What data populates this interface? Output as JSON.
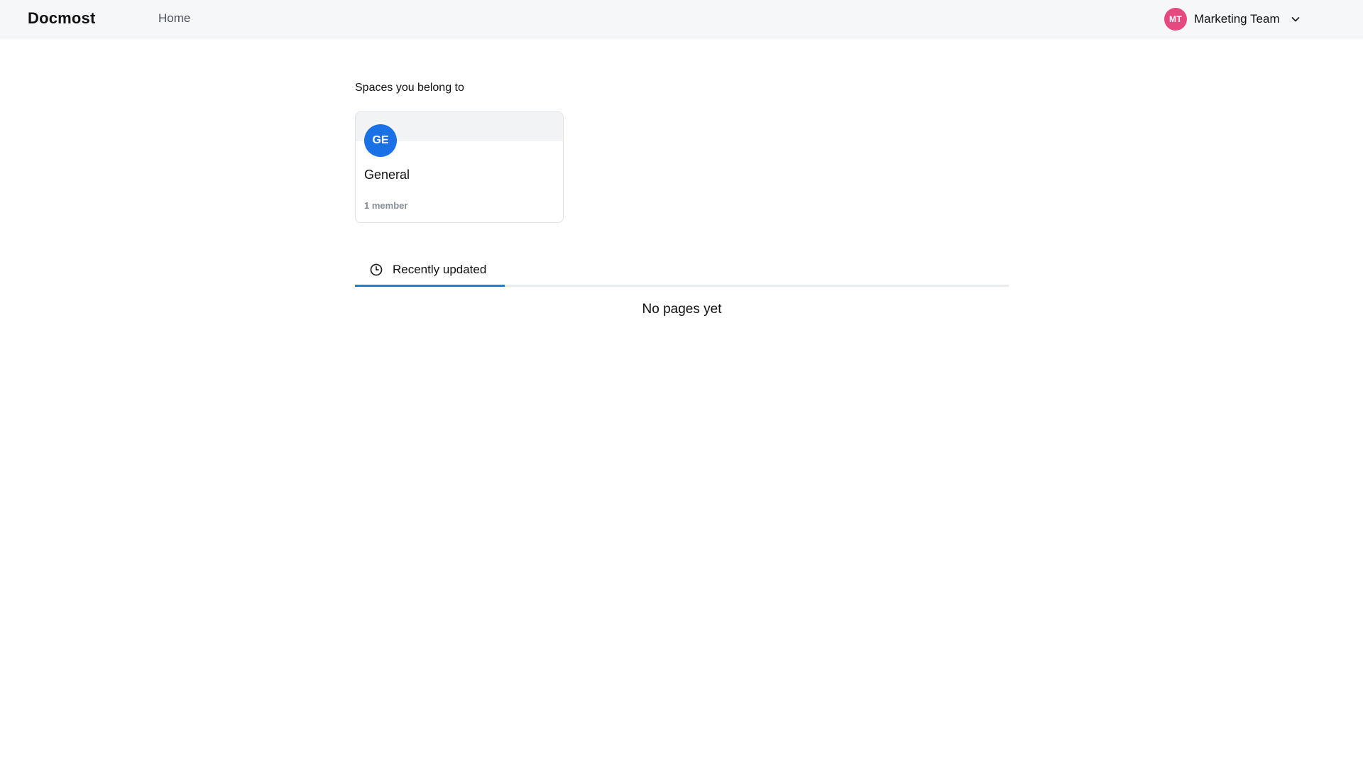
{
  "app": {
    "title": "Docmost"
  },
  "nav": {
    "home_label": "Home"
  },
  "workspace": {
    "initials": "MT",
    "name": "Marketing Team",
    "avatar_color": "#e64980",
    "chevron_icon": "chevron-down-icon"
  },
  "spaces_section": {
    "title": "Spaces you belong to",
    "spaces": [
      {
        "initials": "GE",
        "name": "General",
        "members": "1 member",
        "avatar_color": "#1971e5"
      }
    ]
  },
  "tabs": [
    {
      "label": "Recently updated",
      "icon": "clock-icon",
      "active": true
    }
  ],
  "recent": {
    "empty_text": "No pages yet"
  },
  "colors": {
    "accent": "#1c7ed6",
    "header_bg": "#f6f7f9"
  }
}
